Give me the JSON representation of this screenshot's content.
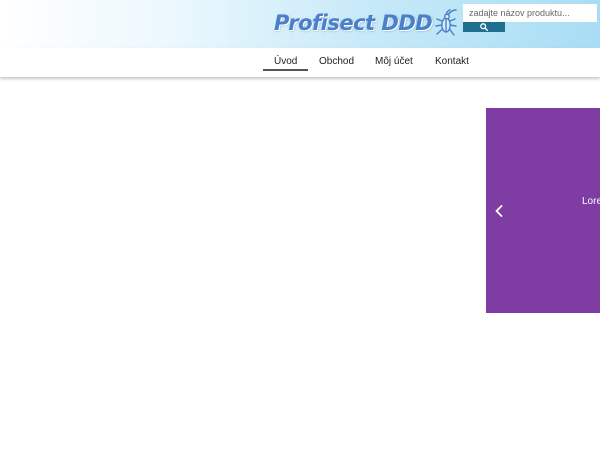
{
  "header": {
    "logo_text": "Profisect DDD",
    "logo_icon": "cockroach-icon",
    "colors": {
      "logo": "#4a7fc9",
      "header_gradient_end": "#a9ddf4"
    }
  },
  "search": {
    "placeholder": "zadajte názov produktu...",
    "button_icon": "search-icon",
    "button_color": "#1f7090"
  },
  "nav": {
    "items": [
      {
        "label": "Úvod",
        "active": true
      },
      {
        "label": "Obchod",
        "active": false
      },
      {
        "label": "Môj účet",
        "active": false
      },
      {
        "label": "Kontakt",
        "active": false
      }
    ]
  },
  "slider": {
    "background": "#7f3ca2",
    "prev_icon": "chevron-left-icon",
    "text": "Lore"
  }
}
